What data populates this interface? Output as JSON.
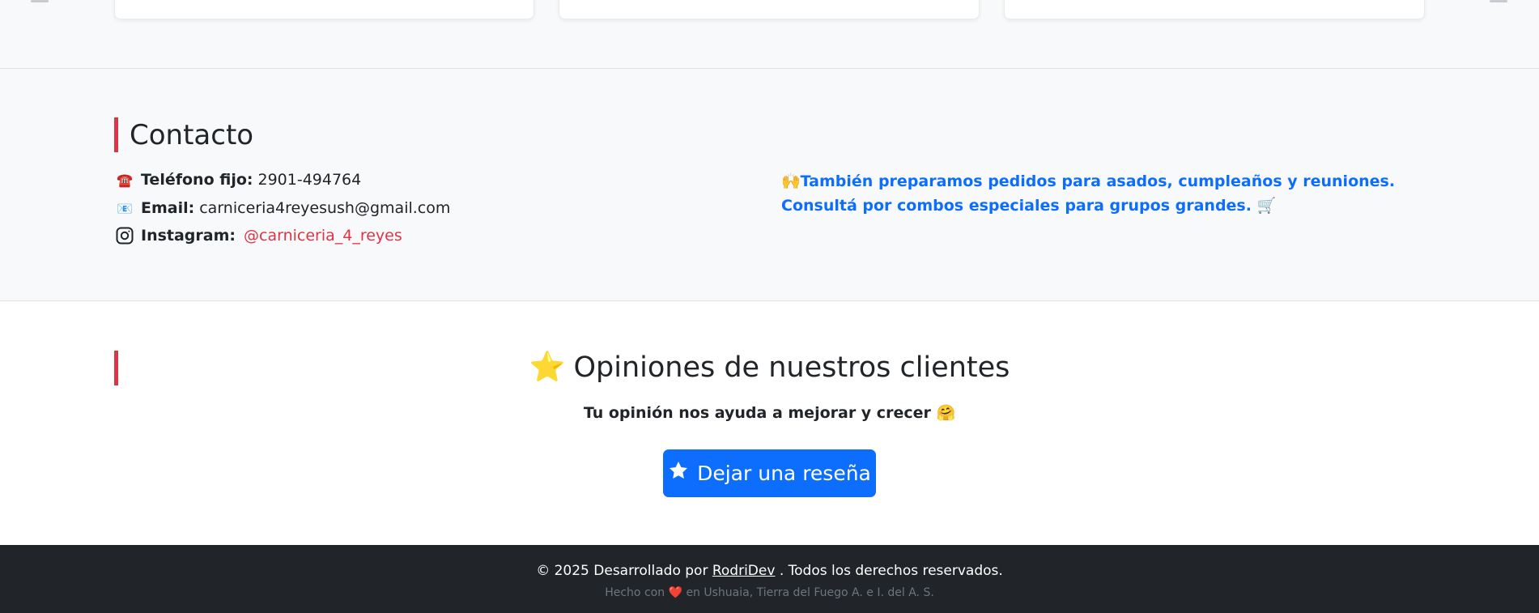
{
  "contact": {
    "title": "Contacto",
    "phone": {
      "icon": "telephone-icon",
      "glyph": "☎️",
      "label": "Teléfono fijo:",
      "value": "2901-494764"
    },
    "email": {
      "icon": "envelope-icon",
      "glyph": "📧",
      "label": "Email:",
      "value": "carniceria4reyesush@gmail.com"
    },
    "instagram": {
      "icon": "instagram-icon",
      "label": "Instagram:",
      "value": "@carniceria_4_reyes"
    },
    "promo": {
      "lead_emoji": "🙌",
      "text": "También preparamos pedidos para asados, cumpleaños y reuniones. Consultá por combos especiales para grupos grandes.",
      "trail_emoji": "🛒"
    }
  },
  "reviews": {
    "title_emoji": "⭐",
    "title": "Opiniones de nuestros clientes",
    "subtitle": "Tu opinión nos ayuda a mejorar y crecer",
    "subtitle_emoji": "🤗",
    "button_label": "Dejar una reseña",
    "button_icon": "star-icon"
  },
  "footer": {
    "copyright_prefix": "© 2025 Desarrollado por",
    "author": "RodriDev",
    "copyright_suffix": ". Todos los derechos reservados.",
    "made_prefix": "Hecho con",
    "heart": "❤️",
    "made_suffix": "en Ushuaia, Tierra del Fuego A. e I. del A. S."
  },
  "colors": {
    "accent_red": "#dc3545",
    "primary_blue": "#0d6efd",
    "footer_bg": "#212529",
    "section_bg": "#f8f9fa"
  }
}
